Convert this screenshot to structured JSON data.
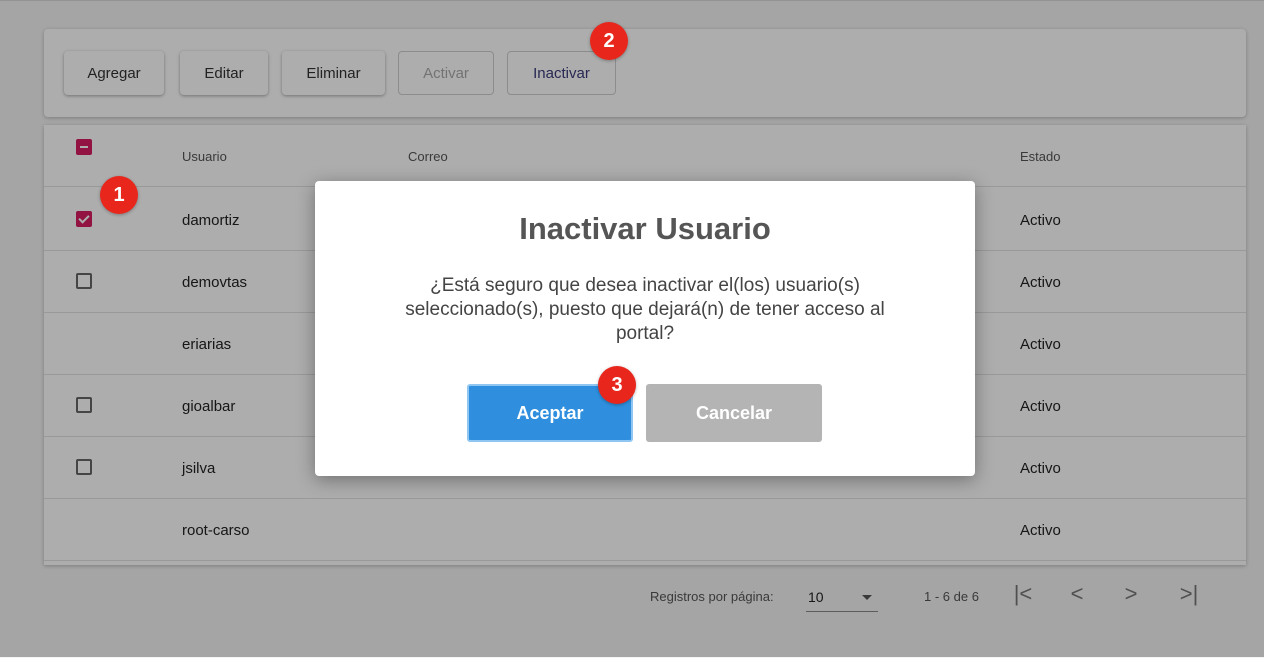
{
  "toolbar": {
    "buttons": [
      {
        "label": "Agregar",
        "enabled": true
      },
      {
        "label": "Editar",
        "enabled": true
      },
      {
        "label": "Eliminar",
        "enabled": true
      },
      {
        "label": "Activar",
        "enabled": false
      },
      {
        "label": "Inactivar",
        "enabled": true
      }
    ]
  },
  "table": {
    "headers": {
      "select_all": "indeterminate",
      "usuario": "Usuario",
      "correo": "Correo",
      "estado": "Estado"
    },
    "rows": [
      {
        "usuario": "damortiz",
        "correo": "",
        "estado": "Activo",
        "checkbox": "checked"
      },
      {
        "usuario": "demovtas",
        "correo": "",
        "estado": "Activo",
        "checkbox": "unchecked"
      },
      {
        "usuario": "eriarias",
        "correo": "",
        "estado": "Activo",
        "checkbox": "none"
      },
      {
        "usuario": "gioalbar",
        "correo": "",
        "estado": "Activo",
        "checkbox": "unchecked"
      },
      {
        "usuario": "jsilva",
        "correo": "",
        "estado": "Activo",
        "checkbox": "unchecked"
      },
      {
        "usuario": "root-carso",
        "correo": "",
        "estado": "Activo",
        "checkbox": "none"
      }
    ]
  },
  "pagination": {
    "per_page_label": "Registros por página:",
    "per_page_value": "10",
    "range": "1 - 6 de 6",
    "first_icon": "|<",
    "prev_icon": "<",
    "next_icon": ">",
    "last_icon": ">|"
  },
  "dialog": {
    "title": "Inactivar Usuario",
    "message": "¿Está seguro que desea inactivar el(los) usuario(s) seleccionado(s), puesto que dejará(n) de tener acceso al portal?",
    "accept_label": "Aceptar",
    "cancel_label": "Cancelar"
  },
  "badges": {
    "step1": "1",
    "step2": "2",
    "step3": "3"
  },
  "colors": {
    "accent": "#d81b60",
    "primary_button": "#2f8fde",
    "badge": "#e8261c"
  }
}
